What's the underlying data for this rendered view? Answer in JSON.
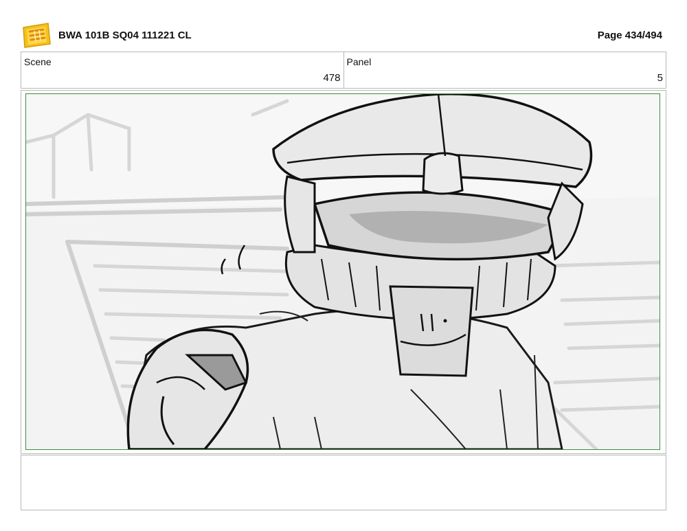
{
  "header": {
    "logo_icon": "young-jedi-adventures-logo",
    "title": "BWA 101B SQ04 111221 CL",
    "page": "Page 434/494"
  },
  "info": {
    "scene_label": "Scene",
    "scene_value": "478",
    "panel_label": "Panel",
    "panel_value": "5"
  },
  "panel": {
    "image_icon": "storyboard-sketch",
    "border_color": "#3f8a3f"
  },
  "notes": {
    "text": ""
  }
}
